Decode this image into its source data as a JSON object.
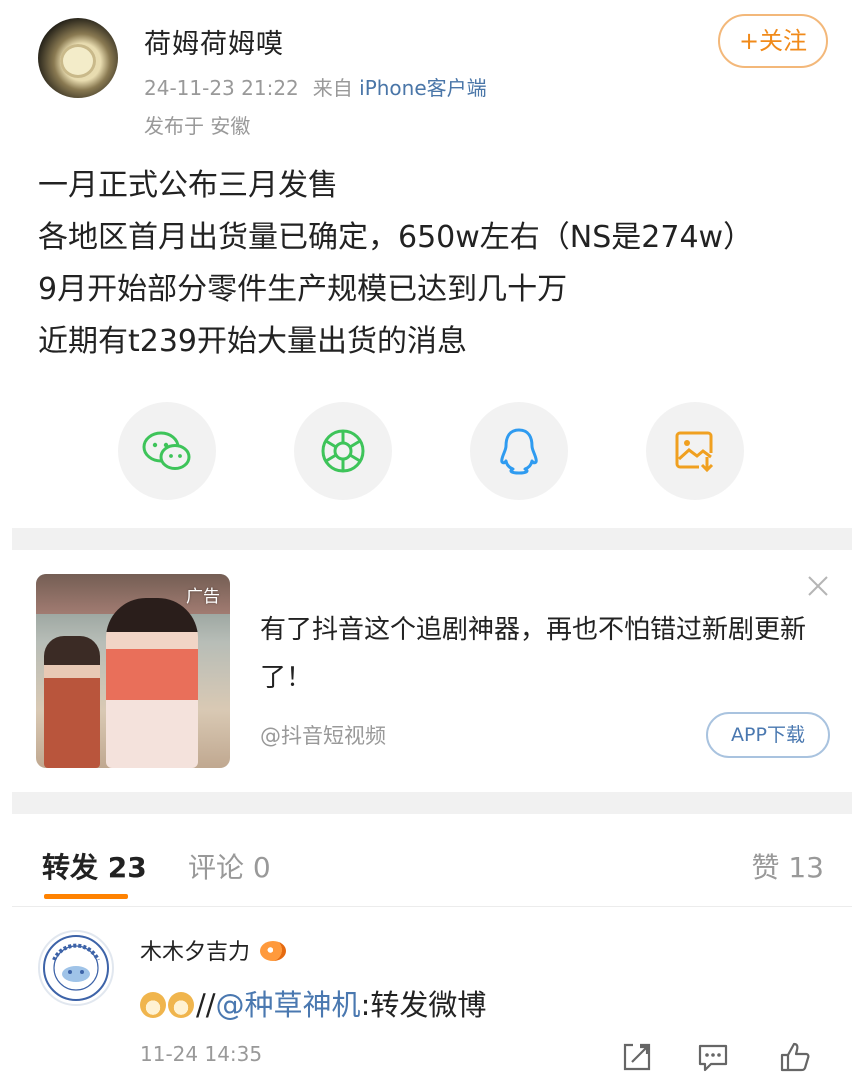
{
  "post": {
    "username": "荷姆荷姆嗼",
    "time": "24-11-23 21:22",
    "from_label": "来自",
    "source": "iPhone客户端",
    "location": "发布于 安徽",
    "follow_label": "+关注",
    "lines": [
      "一月正式公布三月发售",
      "各地区首月出货量已确定，650w左右（NS是274w）",
      "9月开始部分零件生产规模已达到几十万",
      "近期有t239开始大量出货的消息"
    ]
  },
  "share": {
    "icons": [
      "wechat-icon",
      "moments-icon",
      "qq-icon",
      "save-image-icon"
    ],
    "colors": {
      "wechat": "#3ec45a",
      "moments": "#3ec45a",
      "qq": "#2f9bf0",
      "save": "#f0a020"
    }
  },
  "ad": {
    "tag": "广告",
    "title": "有了抖音这个追剧神器，再也不怕错过新剧更新了！",
    "source": "@抖音短视频",
    "button_label": "APP下载"
  },
  "tabs": {
    "repost": "转发 23",
    "comment": "评论 0",
    "likes": "赞 13",
    "accent": "#ff8200"
  },
  "repost": {
    "name": "木木夕吉力",
    "text_sep": "//",
    "mention": "@种草神机",
    "text_rest": ":转发微博",
    "time": "11-24 14:35"
  }
}
